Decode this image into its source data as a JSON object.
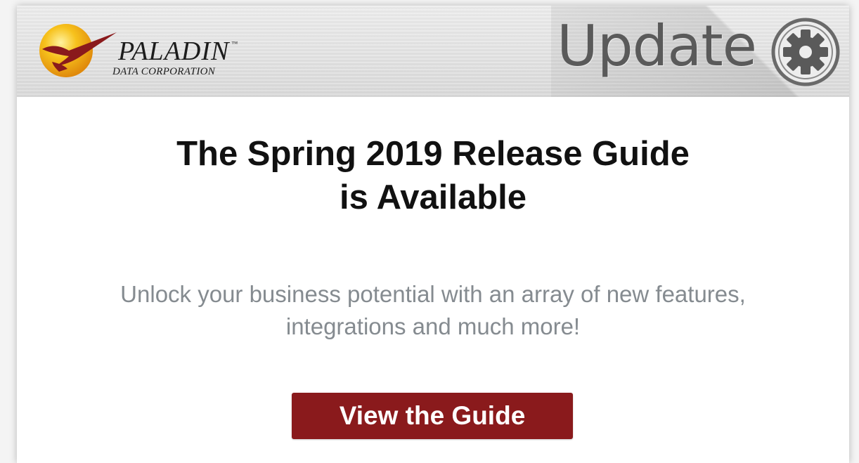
{
  "banner": {
    "logo": {
      "name": "PALADIN",
      "trademark": "™",
      "subtitle": "DATA CORPORATION"
    },
    "update_label": "Update",
    "update_icon": "gear-icon"
  },
  "content": {
    "headline_line1": "The Spring 2019 Release Guide",
    "headline_line2": "is Available",
    "subtext_line1": "Unlock your business potential with an array of new features,",
    "subtext_line2": "integrations and much more!",
    "cta_label": "View the Guide"
  },
  "colors": {
    "accent": "#8a1a1c",
    "subtext": "#858b90",
    "logo_gold": "#f2b818"
  }
}
